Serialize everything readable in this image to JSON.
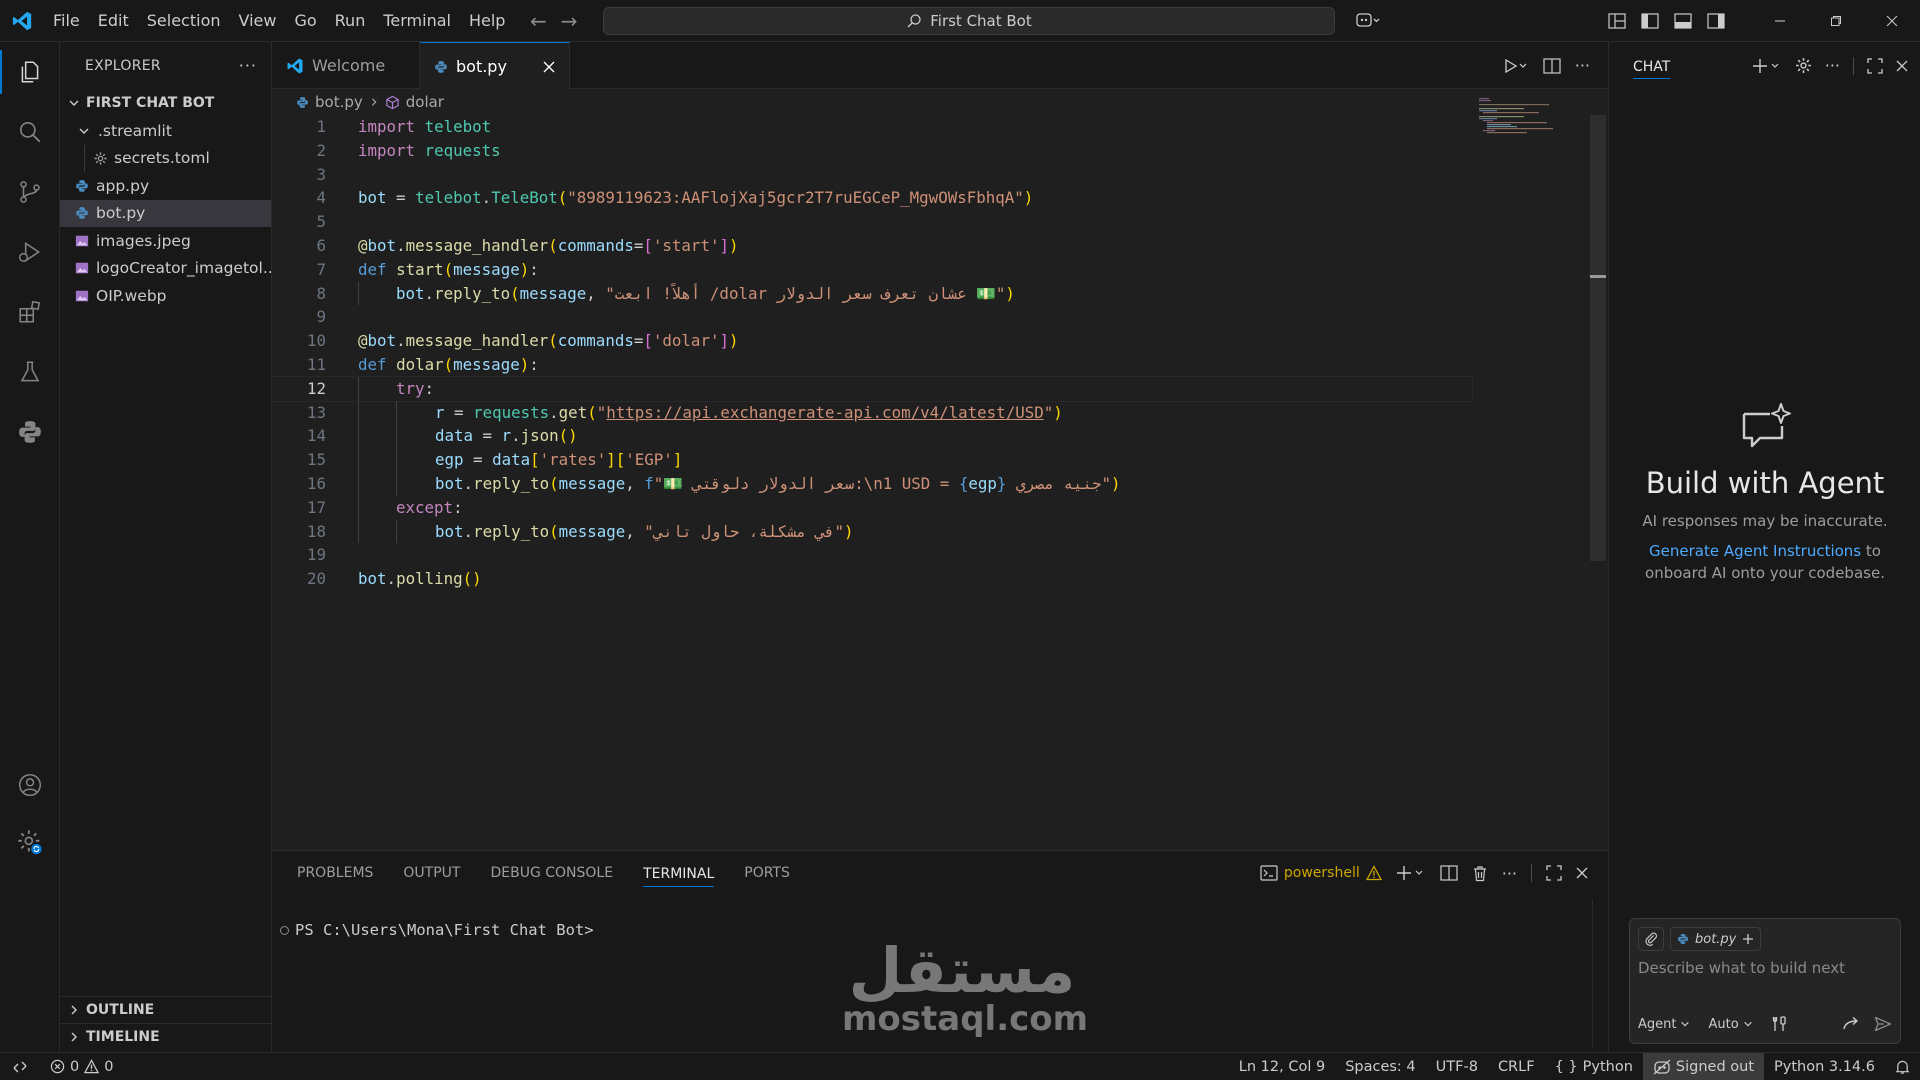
{
  "window": {
    "menu": [
      "File",
      "Edit",
      "Selection",
      "View",
      "Go",
      "Run",
      "Terminal",
      "Help"
    ],
    "search_text": "First Chat Bot"
  },
  "explorer": {
    "header": "EXPLORER",
    "root": "FIRST CHAT BOT",
    "items": [
      {
        "label": ".streamlit",
        "type": "folder"
      },
      {
        "label": "secrets.toml",
        "type": "gear"
      },
      {
        "label": "app.py",
        "type": "python"
      },
      {
        "label": "bot.py",
        "type": "python"
      },
      {
        "label": "images.jpeg",
        "type": "image"
      },
      {
        "label": "logoCreator_imagetol...",
        "type": "image"
      },
      {
        "label": "OIP.webp",
        "type": "image"
      }
    ],
    "outline": "OUTLINE",
    "timeline": "TIMELINE"
  },
  "editor": {
    "tabs": [
      {
        "label": "Welcome"
      },
      {
        "label": "bot.py"
      }
    ],
    "breadcrumb": {
      "file": "bot.py",
      "symbol": "dolar"
    },
    "line_numbers": [
      "1",
      "2",
      "3",
      "4",
      "5",
      "6",
      "7",
      "8",
      "9",
      "10",
      "11",
      "12",
      "13",
      "14",
      "15",
      "16",
      "17",
      "18",
      "19",
      "20"
    ],
    "code": {
      "l1_kw": "import",
      "l1_mod": "telebot",
      "l2_kw": "import",
      "l2_mod": "requests",
      "l4_var": "bot",
      "l4_eq": " = ",
      "l4_mod": "telebot",
      "l4_dot": ".",
      "l4_cls": "TeleBot",
      "l4_str": "\"8989119623:AAFlojXaj5gcr2T7ruEGCeP_MgwOWsFbhqA\"",
      "l6_at": "@",
      "l6_obj": "bot",
      "l6_dot": ".",
      "l6_fn": "message_handler",
      "l6_arg": "commands",
      "l6_eq": "=",
      "l6_str": "'start'",
      "l7_kw": "def",
      "l7_fn": "start",
      "l7_param": "message",
      "l7_colon": ":",
      "l8_obj": "bot",
      "l8_dot": ".",
      "l8_fn": "reply_to",
      "l8_arg": "message",
      "l8_comma": ", ",
      "l8_str": "\"أهلاً! ابعت /dolar عشان تعرف سعر الدولار 💵\"",
      "l10_at": "@",
      "l10_obj": "bot",
      "l10_dot": ".",
      "l10_fn": "message_handler",
      "l10_arg": "commands",
      "l10_eq": "=",
      "l10_str": "'dolar'",
      "l11_kw": "def",
      "l11_fn": "dolar",
      "l11_param": "message",
      "l11_colon": ":",
      "l12_kw": "try",
      "l12_colon": ":",
      "l13_var": "r",
      "l13_eq": " = ",
      "l13_mod": "requests",
      "l13_dot": ".",
      "l13_fn": "get",
      "l13_q1": "\"",
      "l13_url": "https://api.exchangerate-api.com/v4/latest/USD",
      "l13_q2": "\"",
      "l14_var": "data",
      "l14_eq": " = ",
      "l14_obj": "r",
      "l14_dot": ".",
      "l14_fn": "json",
      "l15_var": "egp",
      "l15_eq": " = ",
      "l15_obj": "data",
      "l15_k1": "'rates'",
      "l15_k2": "'EGP'",
      "l16_obj": "bot",
      "l16_dot": ".",
      "l16_fn": "reply_to",
      "l16_arg": "message",
      "l16_comma": ", ",
      "l16_f": "f",
      "l16_s1": "\"💵 سعر الدولار دلوقتي:\\n1 USD = ",
      "l16_var": "egp",
      "l16_s2": " جنيه مصري\"",
      "l17_kw": "except",
      "l17_colon": ":",
      "l18_obj": "bot",
      "l18_dot": ".",
      "l18_fn": "reply_to",
      "l18_arg": "message",
      "l18_comma": ", ",
      "l18_str": "\"في مشكلة، حاول تاني\"",
      "l20_obj": "bot",
      "l20_dot": ".",
      "l20_fn": "polling"
    }
  },
  "panel": {
    "tabs": [
      "PROBLEMS",
      "OUTPUT",
      "DEBUG CONSOLE",
      "TERMINAL",
      "PORTS"
    ],
    "active_tab": "TERMINAL",
    "shell": "powershell",
    "prompt": "PS C:\\Users\\Mona\\First Chat Bot>",
    "watermark_ar": "مستقل",
    "watermark_en": "mostaql.com"
  },
  "chat": {
    "title": "CHAT",
    "heading": "Build with Agent",
    "disclaimer": "AI responses may be inaccurate.",
    "link": "Generate Agent Instructions",
    "link_suffix": " to onboard AI onto your codebase.",
    "context_file": "bot.py",
    "placeholder": "Describe what to build next",
    "mode": "Agent",
    "model": "Auto"
  },
  "statusbar": {
    "errors": "0",
    "warnings": "0",
    "position": "Ln 12, Col 9",
    "spaces": "Spaces: 4",
    "encoding": "UTF-8",
    "eol": "CRLF",
    "language": "Python",
    "account": "Signed out",
    "interpreter": "Python 3.14.6"
  },
  "colors": {
    "accent": "#0078d4",
    "link": "#4daafc",
    "warning": "#cca700"
  }
}
